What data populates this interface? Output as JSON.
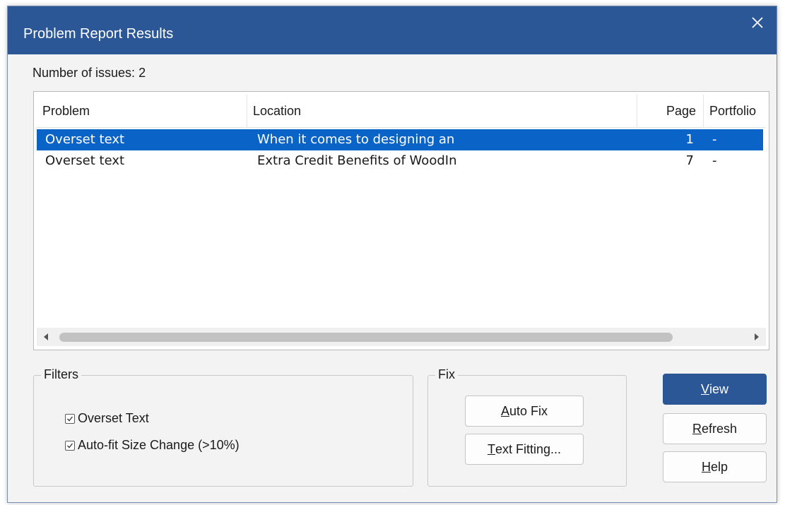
{
  "window": {
    "title": "Problem Report Results"
  },
  "summary": {
    "label": "Number of issues:",
    "count": "2"
  },
  "list": {
    "columns": [
      "Problem",
      "Location",
      "Page",
      "Portfolio"
    ],
    "rows": [
      {
        "problem": "Overset text",
        "location": "When it comes to designing an",
        "page": "1",
        "portfolio": "-",
        "selected": true
      },
      {
        "problem": "Overset text",
        "location": "Extra Credit Benefits of WoodIn",
        "page": "7",
        "portfolio": "-",
        "selected": false
      }
    ]
  },
  "filters": {
    "legend": "Filters",
    "options": [
      {
        "label": "Overset Text",
        "checked": true
      },
      {
        "label": "Auto-fit Size Change (>10%)",
        "checked": true
      }
    ]
  },
  "fix": {
    "legend": "Fix",
    "auto_fix": {
      "mnemonic": "A",
      "rest": "uto Fix"
    },
    "text_fitting": {
      "mnemonic": "T",
      "rest": "ext Fitting..."
    }
  },
  "actions": {
    "view": {
      "mnemonic": "V",
      "rest": "iew"
    },
    "refresh": {
      "mnemonic": "R",
      "rest": "efresh"
    },
    "help": {
      "mnemonic": "H",
      "rest": "elp"
    }
  },
  "colors": {
    "titlebar": "#2b5797",
    "selection": "#0a64c8",
    "primary_button": "#2b5797"
  },
  "icons": {
    "close": "close-icon",
    "scroll_left": "triangle-left-icon",
    "scroll_right": "triangle-right-icon",
    "check": "check-icon"
  }
}
